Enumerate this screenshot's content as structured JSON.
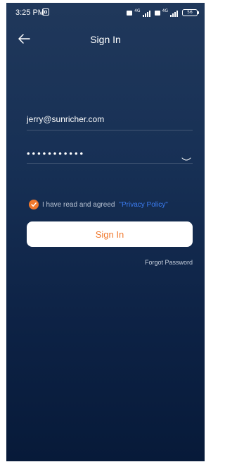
{
  "status_bar": {
    "time": "3:25 PM",
    "network_1": "4G",
    "network_2": "4G",
    "battery": "56"
  },
  "header": {
    "title": "Sign In",
    "back_icon": "arrow-left-icon"
  },
  "form": {
    "email_value": "jerry@sunricher.com",
    "password_value": "•••••••••••",
    "password_toggle_icon": "eye-closed-icon"
  },
  "agreement": {
    "text": "I have read and agreed",
    "link_label": "\"Privacy Policy\"",
    "checked": true
  },
  "actions": {
    "signin_label": "Sign In",
    "forgot_label": "Forgot Password"
  },
  "colors": {
    "accent": "#f0782c",
    "link": "#3b7cf0",
    "background_top": "#20385b",
    "background_bottom": "#071a39"
  }
}
